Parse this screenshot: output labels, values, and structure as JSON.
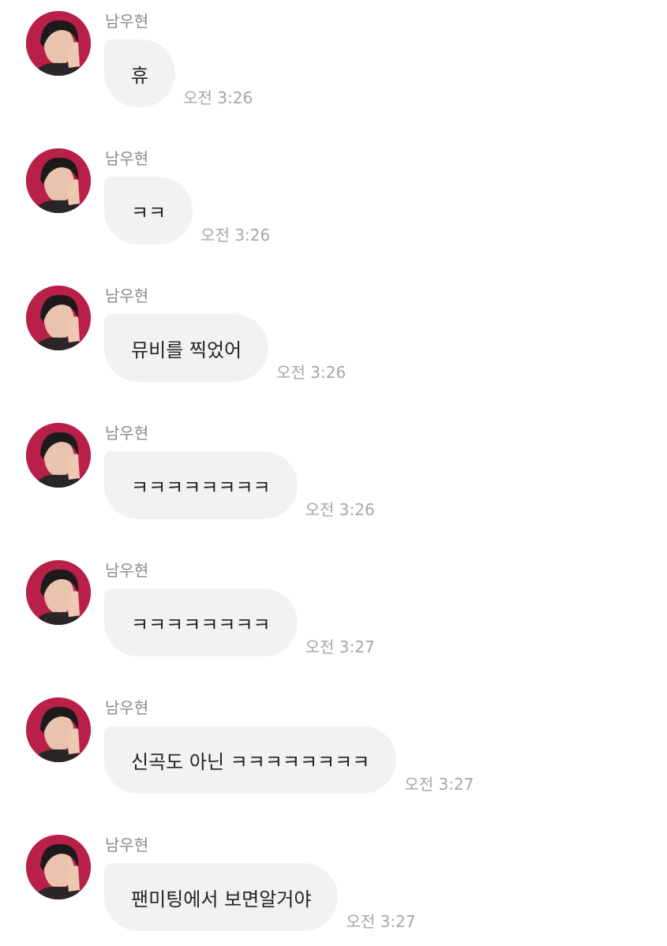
{
  "colors": {
    "bubble": "#f2f2f4",
    "sender": "#8a8a8a",
    "timestamp": "#a6a6a6",
    "avatar_bg": "#b8204a"
  },
  "messages": [
    {
      "sender": "남우현",
      "text": "휴",
      "time": "오전 3:26",
      "avatar_icon": "profile-photo-icon"
    },
    {
      "sender": "남우현",
      "text": "ㅋㅋ",
      "time": "오전 3:26",
      "avatar_icon": "profile-photo-icon"
    },
    {
      "sender": "남우현",
      "text": "뮤비를 찍었어",
      "time": "오전 3:26",
      "avatar_icon": "profile-photo-icon"
    },
    {
      "sender": "남우현",
      "text": "ㅋㅋㅋㅋㅋㅋㅋㅋ",
      "time": "오전 3:26",
      "avatar_icon": "profile-photo-icon"
    },
    {
      "sender": "남우현",
      "text": "ㅋㅋㅋㅋㅋㅋㅋㅋ",
      "time": "오전 3:27",
      "avatar_icon": "profile-photo-icon"
    },
    {
      "sender": "남우현",
      "text": "신곡도 아닌 ㅋㅋㅋㅋㅋㅋㅋㅋ",
      "time": "오전 3:27",
      "avatar_icon": "profile-photo-icon"
    },
    {
      "sender": "남우현",
      "text": "팬미팅에서 보면알거야",
      "time": "오전 3:27",
      "avatar_icon": "profile-photo-icon"
    }
  ]
}
